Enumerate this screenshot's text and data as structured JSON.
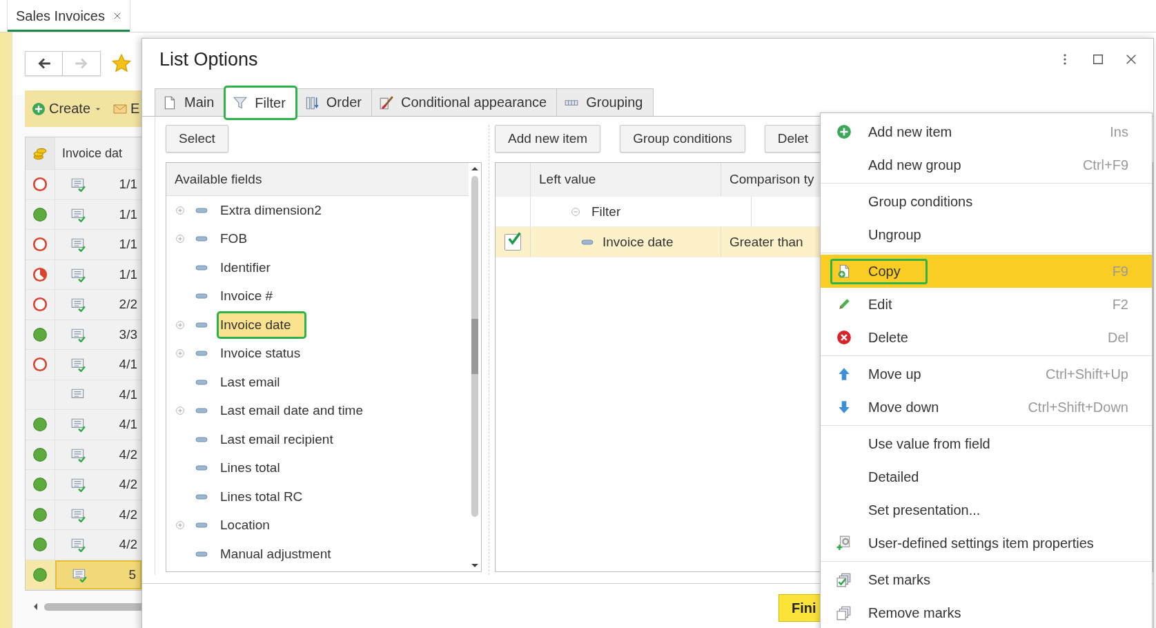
{
  "app_tabs": [
    {
      "label": "Sales Invoices",
      "selected": true
    }
  ],
  "list_page": {
    "toolbar": [
      {
        "kind": "create",
        "label": "Create"
      },
      {
        "kind": "email",
        "label": "E"
      }
    ],
    "columns": [
      {
        "kind": "status"
      },
      {
        "kind": "text",
        "label": "Invoice dat"
      }
    ],
    "rows": [
      {
        "kind": "open",
        "posted": true,
        "date": "1/1",
        "selected": false
      },
      {
        "kind": "paid",
        "posted": true,
        "date": "1/1",
        "selected": false
      },
      {
        "kind": "open",
        "posted": true,
        "date": "1/1",
        "selected": false
      },
      {
        "kind": "partial",
        "posted": true,
        "date": "1/1",
        "selected": false
      },
      {
        "kind": "open",
        "posted": true,
        "date": "2/2",
        "selected": false
      },
      {
        "kind": "paid",
        "posted": true,
        "date": "3/3",
        "selected": false
      },
      {
        "kind": "open",
        "posted": true,
        "date": "4/1",
        "selected": false
      },
      {
        "kind": "none",
        "posted": false,
        "date": "4/1",
        "selected": false
      },
      {
        "kind": "paid",
        "posted": true,
        "date": "4/1",
        "selected": false
      },
      {
        "kind": "paid",
        "posted": true,
        "date": "4/2",
        "selected": false
      },
      {
        "kind": "paid",
        "posted": true,
        "date": "4/2",
        "selected": false
      },
      {
        "kind": "paid",
        "posted": true,
        "date": "4/2",
        "selected": false
      },
      {
        "kind": "paid",
        "posted": true,
        "date": "4/2",
        "selected": false
      },
      {
        "kind": "paid",
        "posted": true,
        "date": "5",
        "selected": true
      }
    ]
  },
  "dialog": {
    "title": "List Options",
    "tabs": [
      {
        "label": "Main",
        "kind": "main",
        "selected": false,
        "outlined": false
      },
      {
        "label": "Filter",
        "kind": "filter",
        "selected": true,
        "outlined": true
      },
      {
        "label": "Order",
        "kind": "order",
        "selected": false,
        "outlined": false
      },
      {
        "label": "Conditional appearance",
        "kind": "appearance",
        "selected": false,
        "outlined": false
      },
      {
        "label": "Grouping",
        "kind": "grouping",
        "selected": false,
        "outlined": false
      }
    ],
    "fields_panel": {
      "button": "Select",
      "header": "Available fields",
      "items": [
        {
          "label": "Extra dimension2",
          "expandable": true,
          "selected": false,
          "outlined": false
        },
        {
          "label": "FOB",
          "expandable": true,
          "selected": false,
          "outlined": false
        },
        {
          "label": "Identifier",
          "expandable": false,
          "selected": false,
          "outlined": false
        },
        {
          "label": "Invoice #",
          "expandable": false,
          "selected": false,
          "outlined": false
        },
        {
          "label": "Invoice date",
          "expandable": true,
          "selected": true,
          "outlined": true
        },
        {
          "label": "Invoice status",
          "expandable": true,
          "selected": false,
          "outlined": false
        },
        {
          "label": "Last email",
          "expandable": false,
          "selected": false,
          "outlined": false
        },
        {
          "label": "Last email date and time",
          "expandable": true,
          "selected": false,
          "outlined": false
        },
        {
          "label": "Last email recipient",
          "expandable": false,
          "selected": false,
          "outlined": false
        },
        {
          "label": "Lines total",
          "expandable": false,
          "selected": false,
          "outlined": false
        },
        {
          "label": "Lines total RC",
          "expandable": false,
          "selected": false,
          "outlined": false
        },
        {
          "label": "Location",
          "expandable": true,
          "selected": false,
          "outlined": false
        },
        {
          "label": "Manual adjustment",
          "expandable": false,
          "selected": false,
          "outlined": false
        }
      ]
    },
    "filter_panel": {
      "buttons": [
        "Add new item",
        "Group conditions",
        "Delet"
      ],
      "columns": [
        "Left value",
        "Comparison ty"
      ],
      "rows": [
        {
          "kind": "group",
          "left_value": "Filter",
          "expanded": true,
          "selected": false
        },
        {
          "kind": "condition",
          "checked": true,
          "left_value": "Invoice date",
          "comparison": "Greater than",
          "selected": true
        }
      ]
    },
    "finish_button": "Fini"
  },
  "context_menu": {
    "items": [
      {
        "kind": "add",
        "label": "Add new item",
        "shortcut": "Ins",
        "selected": false,
        "outlined": false
      },
      {
        "kind": "plain",
        "label": "Add new group",
        "shortcut": "Ctrl+F9",
        "selected": false,
        "outlined": false
      },
      {
        "kind": "separator"
      },
      {
        "kind": "plain",
        "label": "Group conditions",
        "selected": false,
        "outlined": false
      },
      {
        "kind": "plain",
        "label": "Ungroup",
        "selected": false,
        "outlined": false
      },
      {
        "kind": "separator"
      },
      {
        "kind": "copy",
        "label": "Copy",
        "shortcut": "F9",
        "selected": true,
        "outlined": true
      },
      {
        "kind": "edit",
        "label": "Edit",
        "shortcut": "F2",
        "selected": false,
        "outlined": false
      },
      {
        "kind": "delete",
        "label": "Delete",
        "shortcut": "Del",
        "selected": false,
        "outlined": false
      },
      {
        "kind": "separator"
      },
      {
        "kind": "up",
        "label": "Move up",
        "shortcut": "Ctrl+Shift+Up",
        "selected": false,
        "outlined": false
      },
      {
        "kind": "down",
        "label": "Move down",
        "shortcut": "Ctrl+Shift+Down",
        "selected": false,
        "outlined": false
      },
      {
        "kind": "separator"
      },
      {
        "kind": "plain",
        "label": "Use value from field",
        "selected": false,
        "outlined": false
      },
      {
        "kind": "plain",
        "label": "Detailed",
        "selected": false,
        "outlined": false
      },
      {
        "kind": "plain",
        "label": "Set presentation...",
        "selected": false,
        "outlined": false
      },
      {
        "kind": "props",
        "label": "User-defined settings item properties",
        "selected": false,
        "outlined": false
      },
      {
        "kind": "separator"
      },
      {
        "kind": "marks",
        "label": "Set marks",
        "selected": false,
        "outlined": false
      },
      {
        "kind": "unmarks",
        "label": "Remove marks",
        "selected": false,
        "outlined": false
      }
    ]
  }
}
